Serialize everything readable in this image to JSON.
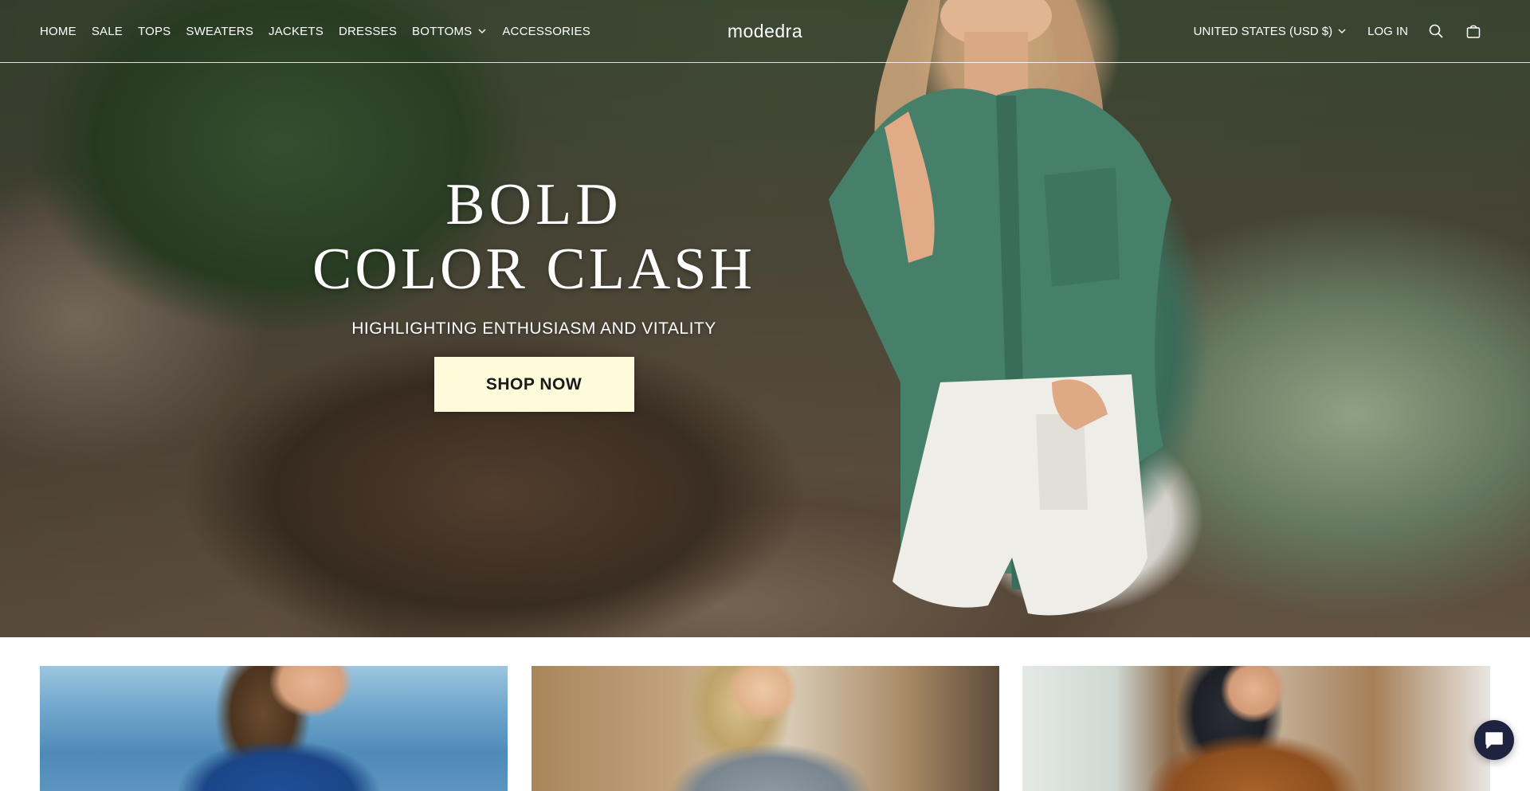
{
  "nav": {
    "items": [
      {
        "label": "HOME"
      },
      {
        "label": "SALE"
      },
      {
        "label": "TOPS"
      },
      {
        "label": "SWEATERS"
      },
      {
        "label": "JACKETS"
      },
      {
        "label": "DRESSES"
      },
      {
        "label": "BOTTOMS",
        "icon": "chevron-down-icon"
      },
      {
        "label": "ACCESSORIES"
      }
    ]
  },
  "logo": {
    "text": "modedra"
  },
  "utility": {
    "country": "UNITED STATES (USD $)",
    "country_icon": "chevron-down-icon",
    "login": "LOG IN",
    "search_icon": "search-icon",
    "cart_icon": "shopping-bag-icon"
  },
  "hero": {
    "line1": "BOLD",
    "line2": "COLOR CLASH",
    "subtitle": "HIGHLIGHTING ENTHUSIASM AND VITALITY",
    "cta_label": "SHOP NOW",
    "cta_color": "#fefbda"
  },
  "cards": [
    {
      "alt": "model in blue top by the sea"
    },
    {
      "alt": "model in grey sweater"
    },
    {
      "alt": "model in brown corduroy jacket"
    }
  ],
  "chat": {
    "icon": "chat-bubble-icon"
  }
}
